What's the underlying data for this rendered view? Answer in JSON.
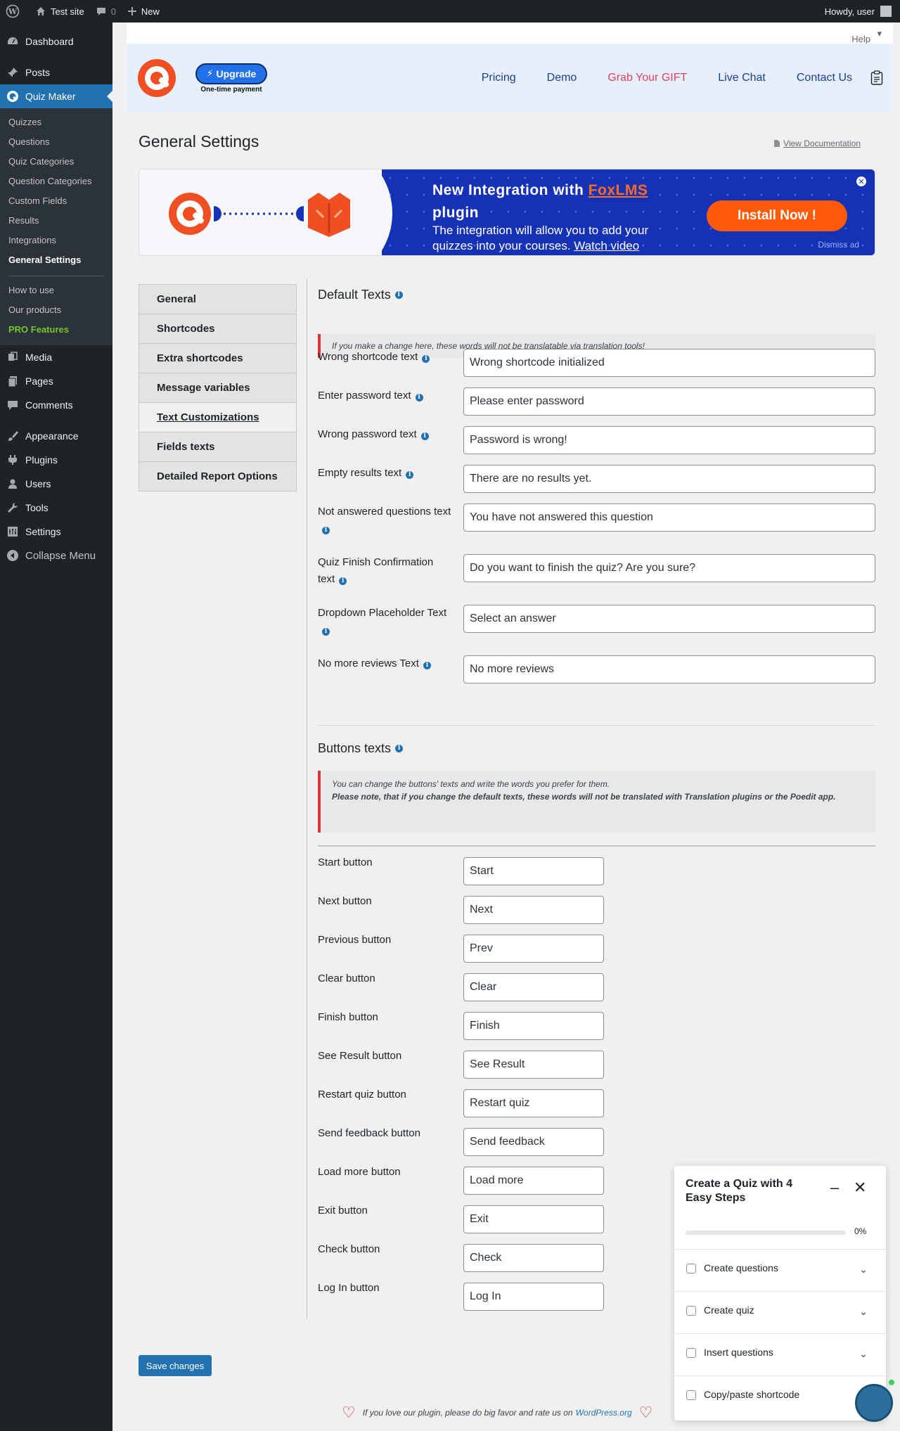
{
  "adminbar": {
    "site_name": "Test site",
    "comments_count": "0",
    "new_label": "New",
    "howdy": "Howdy, user"
  },
  "sidebar": {
    "dashboard": "Dashboard",
    "posts": "Posts",
    "quiz_maker": "Quiz Maker",
    "submenu": [
      "Quizzes",
      "Questions",
      "Quiz Categories",
      "Question Categories",
      "Custom Fields",
      "Results",
      "Integrations",
      "General Settings"
    ],
    "submenu2": [
      "How to use",
      "Our products",
      "PRO Features"
    ],
    "media": "Media",
    "pages": "Pages",
    "comments": "Comments",
    "appearance": "Appearance",
    "plugins": "Plugins",
    "users": "Users",
    "tools": "Tools",
    "settings": "Settings",
    "collapse": "Collapse Menu"
  },
  "help_label": "Help",
  "header": {
    "upgrade": "Upgrade",
    "upgrade_note": "One-time payment",
    "nav": [
      "Pricing",
      "Demo",
      "Grab Your GIFT",
      "Live Chat",
      "Contact Us"
    ]
  },
  "page": {
    "title": "General Settings",
    "doc_link": "View Documentation"
  },
  "banner": {
    "title_pre": "New Integration with ",
    "title_brand": "FoxLMS",
    "title_post": " plugin",
    "text_pre": "The integration will allow you to add your quizzes into your courses. ",
    "text_link": "Watch video",
    "install": "Install Now !",
    "dismiss": "Dismiss ad"
  },
  "tabs": [
    "General",
    "Shortcodes",
    "Extra shortcodes",
    "Message variables",
    "Text Customizations",
    "Fields texts",
    "Detailed Report Options"
  ],
  "default_texts": {
    "title": "Default Texts",
    "notice": "If you make a change here, these words will not be translatable via translation tools!",
    "fields": [
      {
        "label": "Wrong shortcode text",
        "value": "Wrong shortcode initialized"
      },
      {
        "label": "Enter password text",
        "value": "Please enter password"
      },
      {
        "label": "Wrong password text",
        "value": "Password is wrong!"
      },
      {
        "label": "Empty results text",
        "value": "There are no results yet."
      },
      {
        "label": "Not answered questions text",
        "value": "You have not answered this question"
      },
      {
        "label": "Quiz Finish Confirmation text",
        "value": "Do you want to finish the quiz? Are you sure?"
      },
      {
        "label": "Dropdown Placeholder Text",
        "value": "Select an answer"
      },
      {
        "label": "No more reviews Text",
        "value": "No more reviews"
      }
    ]
  },
  "buttons_texts": {
    "title": "Buttons texts",
    "notice_line1": "You can change the buttons' texts and write the words you prefer for them.",
    "notice_line2": "Please note, that if you change the default texts, these words will not be translated with Translation plugins or the Poedit app.",
    "fields": [
      {
        "label": "Start button",
        "value": "Start"
      },
      {
        "label": "Next button",
        "value": "Next"
      },
      {
        "label": "Previous button",
        "value": "Prev"
      },
      {
        "label": "Clear button",
        "value": "Clear"
      },
      {
        "label": "Finish button",
        "value": "Finish"
      },
      {
        "label": "See Result button",
        "value": "See Result"
      },
      {
        "label": "Restart quiz button",
        "value": "Restart quiz"
      },
      {
        "label": "Send feedback button",
        "value": "Send feedback"
      },
      {
        "label": "Load more button",
        "value": "Load more"
      },
      {
        "label": "Exit button",
        "value": "Exit"
      },
      {
        "label": "Check button",
        "value": "Check"
      },
      {
        "label": "Log In button",
        "value": "Log In"
      }
    ]
  },
  "save_button": "Save changes",
  "footer": {
    "text": "If you love our plugin, please do big favor and rate us on",
    "link": "WordPress.org"
  },
  "steps_widget": {
    "title": "Create a Quiz with 4 Easy Steps",
    "progress_label": "0%",
    "progress": 0,
    "steps": [
      "Create questions",
      "Create quiz",
      "Insert questions",
      "Copy/paste shortcode"
    ]
  }
}
